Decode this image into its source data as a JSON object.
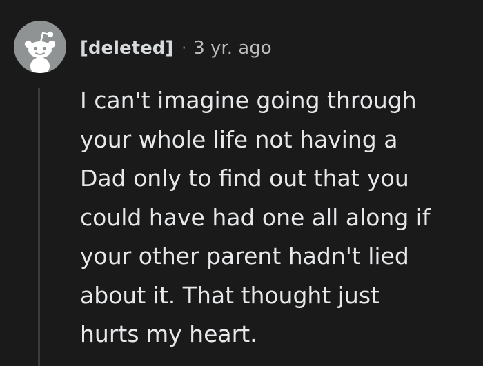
{
  "comment": {
    "author": "[deleted]",
    "separator": "·",
    "timestamp": "3 yr. ago",
    "avatar_icon": "reddit-snoo-icon",
    "body_lines": [
      "I can't imagine going through",
      "your whole life not having a",
      "Dad only to find out that you",
      "could have had one all along if",
      "your other parent hadn't lied",
      "about it. That thought just",
      "hurts my heart."
    ]
  },
  "colors": {
    "background": "#1a1a1b",
    "text": "#e6e8ea",
    "meta_text": "#b9bbbd",
    "avatar_bg": "#8f9394",
    "thread_line": "#3b3c3d"
  }
}
